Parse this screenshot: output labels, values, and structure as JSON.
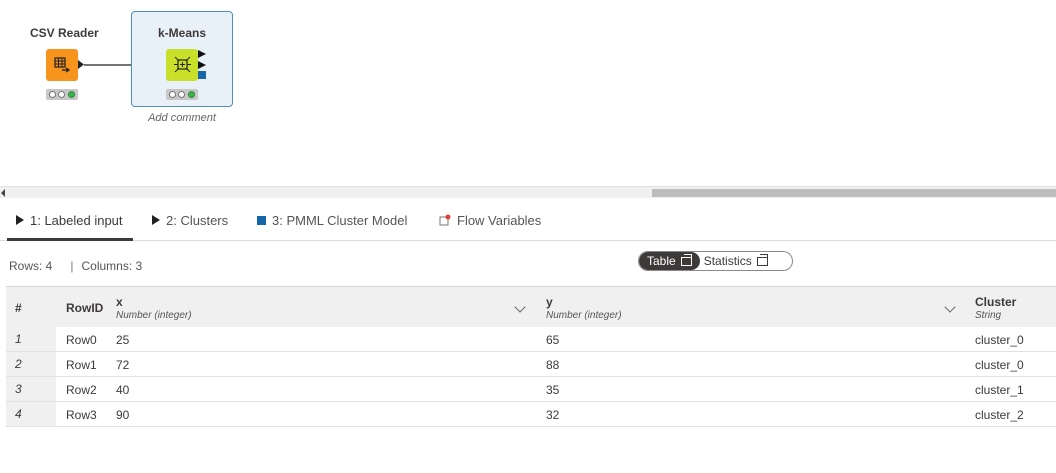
{
  "workflow": {
    "nodes": [
      {
        "title": "CSV Reader",
        "status": [
          "idle",
          "idle",
          "ok"
        ]
      },
      {
        "title": "k-Means",
        "status": [
          "idle",
          "idle",
          "ok"
        ],
        "comment": "Add comment"
      }
    ]
  },
  "tabs": [
    {
      "label": "1: Labeled input",
      "icon": "play-triangle-icon",
      "active": true
    },
    {
      "label": "2: Clusters",
      "icon": "play-triangle-icon",
      "active": false
    },
    {
      "label": "3: PMML Cluster Model",
      "icon": "blue-square-port-icon",
      "active": false
    },
    {
      "label": "Flow Variables",
      "icon": "flow-variable-icon",
      "active": false
    }
  ],
  "table_meta": {
    "rows": "Rows: 4",
    "separator": "|",
    "columns": "Columns: 3"
  },
  "view_toggle": {
    "table": "Table",
    "statistics": "Statistics",
    "selected": "Table"
  },
  "table": {
    "index_header": "#",
    "columns": [
      {
        "name": "RowID",
        "type": ""
      },
      {
        "name": "x",
        "type": "Number (integer)"
      },
      {
        "name": "y",
        "type": "Number (integer)"
      },
      {
        "name": "Cluster",
        "type": "String"
      }
    ],
    "rows": [
      {
        "index": "1",
        "rowid": "Row0",
        "x": "25",
        "y": "65",
        "cluster": "cluster_0"
      },
      {
        "index": "2",
        "rowid": "Row1",
        "x": "72",
        "y": "88",
        "cluster": "cluster_0"
      },
      {
        "index": "3",
        "rowid": "Row2",
        "x": "40",
        "y": "35",
        "cluster": "cluster_1"
      },
      {
        "index": "4",
        "rowid": "Row3",
        "x": "90",
        "y": "32",
        "cluster": "cluster_2"
      }
    ]
  },
  "colors": {
    "csv_node": "#f7941d",
    "kmeans_node": "#c9e02b",
    "pmml_port": "#1565a8",
    "selection": "#4f8fc3"
  }
}
